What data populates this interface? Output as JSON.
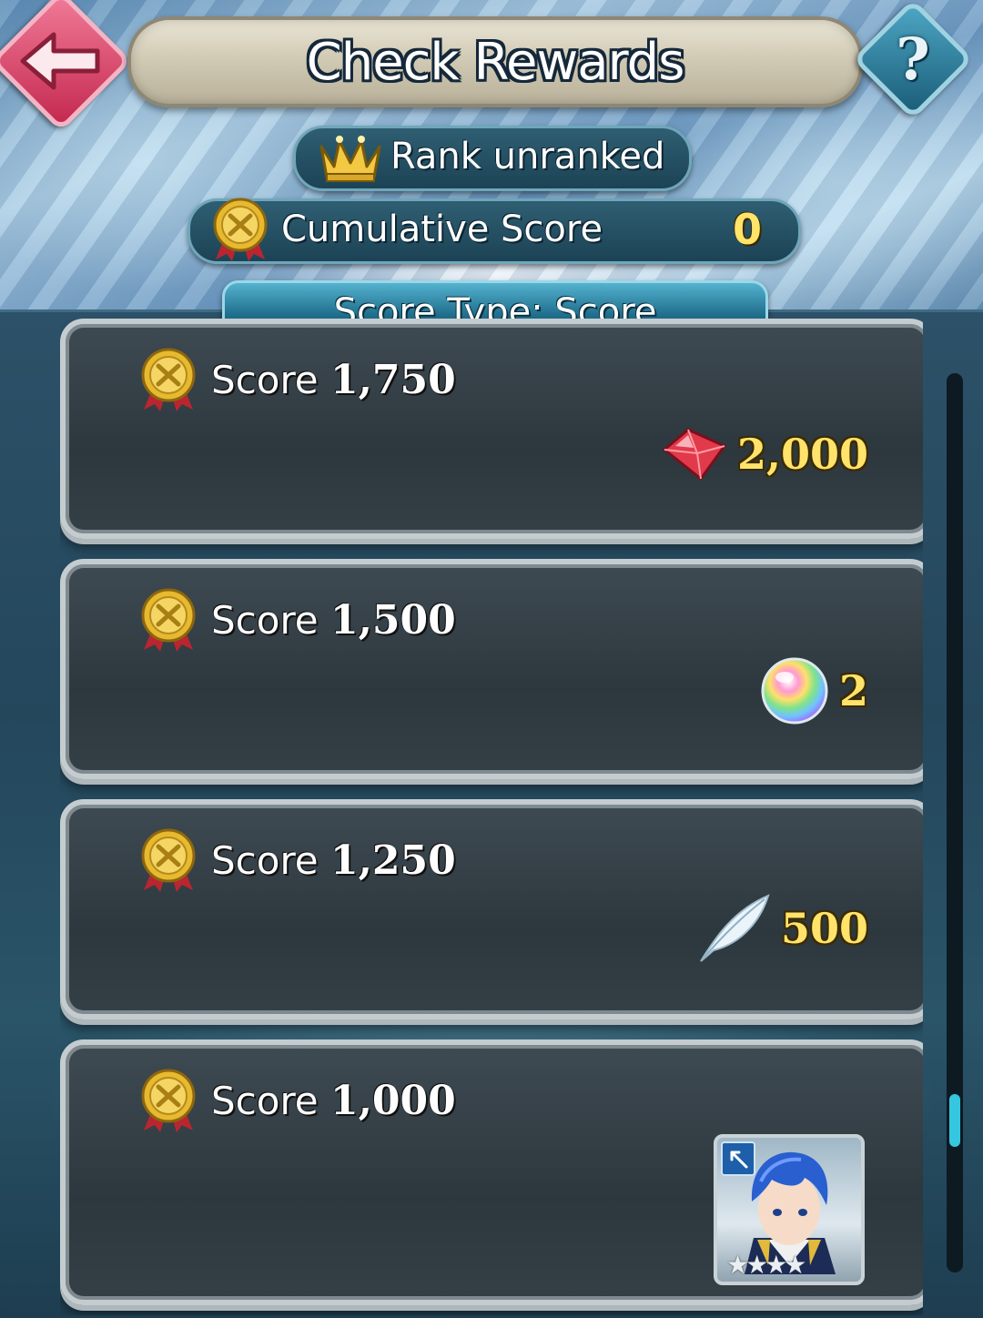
{
  "header": {
    "title": "Check Rewards",
    "help_label": "?"
  },
  "rank": {
    "label": "Rank  unranked"
  },
  "cumulative": {
    "label": "Cumulative Score",
    "value": "0"
  },
  "score_type": {
    "label": "Score Type: Score"
  },
  "rewards": [
    {
      "prefix": "Score",
      "threshold": "1,750",
      "reward_icon": "orb-icon",
      "amount": "2,000"
    },
    {
      "prefix": "Score",
      "threshold": "1,500",
      "reward_icon": "divine-dew-sphere-icon",
      "amount": "2"
    },
    {
      "prefix": "Score",
      "threshold": "1,250",
      "reward_icon": "feather-icon",
      "amount": "500"
    },
    {
      "prefix": "Score",
      "threshold": "1,000",
      "reward_icon": "hero-portrait",
      "amount": ""
    }
  ],
  "colors": {
    "accent_gold": "#ffe36b",
    "back_button": "#d8395f",
    "help_button": "#2a87a6",
    "scroll_thumb": "#36c7e0"
  }
}
